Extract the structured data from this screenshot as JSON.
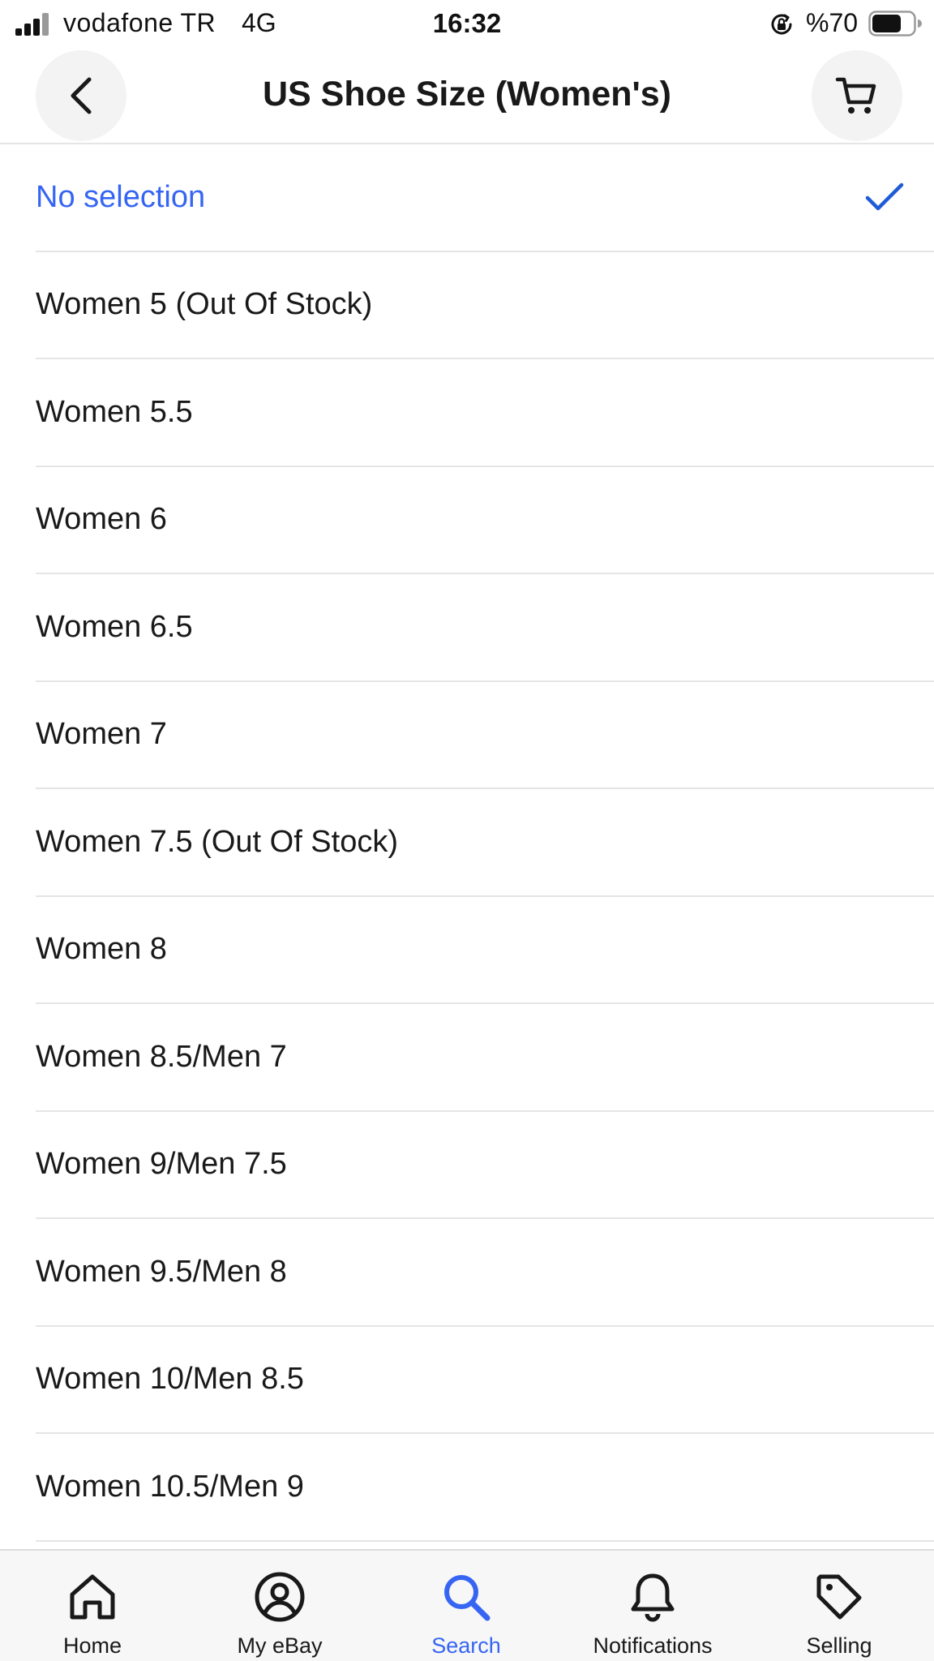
{
  "status_bar": {
    "carrier": "vodafone TR",
    "network": "4G",
    "time": "16:32",
    "battery_percent": "%70",
    "battery_level": 0.7
  },
  "header": {
    "title": "US Shoe Size (Women's)",
    "back_icon": "chevron-left-icon",
    "cart_icon": "cart-icon"
  },
  "options": [
    {
      "label": "No selection",
      "selected": true
    },
    {
      "label": "Women 5 (Out Of Stock)",
      "selected": false
    },
    {
      "label": "Women 5.5",
      "selected": false
    },
    {
      "label": "Women 6",
      "selected": false
    },
    {
      "label": "Women 6.5",
      "selected": false
    },
    {
      "label": "Women 7",
      "selected": false
    },
    {
      "label": "Women 7.5 (Out Of Stock)",
      "selected": false
    },
    {
      "label": "Women 8",
      "selected": false
    },
    {
      "label": "Women 8.5/Men 7",
      "selected": false
    },
    {
      "label": "Women 9/Men 7.5",
      "selected": false
    },
    {
      "label": "Women 9.5/Men 8",
      "selected": false
    },
    {
      "label": "Women 10/Men 8.5",
      "selected": false
    },
    {
      "label": "Women 10.5/Men 9",
      "selected": false
    }
  ],
  "bottom_nav": [
    {
      "label": "Home",
      "icon": "home-icon",
      "active": false
    },
    {
      "label": "My eBay",
      "icon": "user-circle-icon",
      "active": false
    },
    {
      "label": "Search",
      "icon": "search-icon",
      "active": true
    },
    {
      "label": "Notifications",
      "icon": "bell-icon",
      "active": false
    },
    {
      "label": "Selling",
      "icon": "tag-icon",
      "active": false
    }
  ],
  "colors": {
    "accent": "#3665f3",
    "check": "#1e5bd6",
    "text": "#191919",
    "divider": "#e5e5e5"
  }
}
